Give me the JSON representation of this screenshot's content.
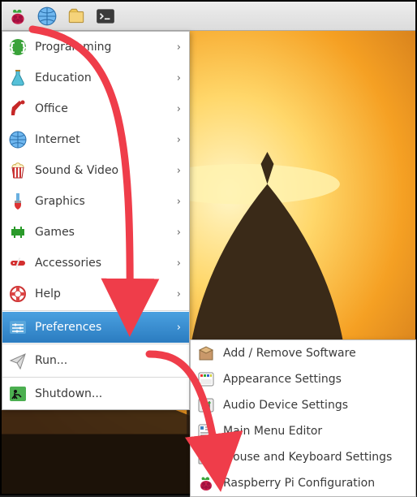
{
  "taskbar": {
    "items": [
      {
        "name": "raspberry-icon"
      },
      {
        "name": "globe-icon"
      },
      {
        "name": "files-icon"
      },
      {
        "name": "terminal-icon"
      }
    ]
  },
  "menu": {
    "items": [
      {
        "name": "programming",
        "label": "Programming",
        "icon": "braces-icon",
        "submenu": true
      },
      {
        "name": "education",
        "label": "Education",
        "icon": "flask-icon",
        "submenu": true
      },
      {
        "name": "office",
        "label": "Office",
        "icon": "lamp-icon",
        "submenu": true
      },
      {
        "name": "internet",
        "label": "Internet",
        "icon": "globe-icon",
        "submenu": true
      },
      {
        "name": "sound-video",
        "label": "Sound & Video",
        "icon": "popcorn-icon",
        "submenu": true
      },
      {
        "name": "graphics",
        "label": "Graphics",
        "icon": "brush-icon",
        "submenu": true
      },
      {
        "name": "games",
        "label": "Games",
        "icon": "invader-icon",
        "submenu": true
      },
      {
        "name": "accessories",
        "label": "Accessories",
        "icon": "knife-icon",
        "submenu": true
      },
      {
        "name": "help",
        "label": "Help",
        "icon": "lifebuoy-icon",
        "submenu": true
      }
    ],
    "preferences": {
      "name": "preferences",
      "label": "Preferences",
      "icon": "sliders-icon",
      "submenu": true,
      "selected": true
    },
    "run": {
      "name": "run",
      "label": "Run...",
      "icon": "paperplane-icon"
    },
    "shutdown": {
      "name": "shutdown",
      "label": "Shutdown...",
      "icon": "exit-icon"
    }
  },
  "submenu": {
    "items": [
      {
        "name": "add-remove-software",
        "label": "Add / Remove Software",
        "icon": "package-icon"
      },
      {
        "name": "appearance-settings",
        "label": "Appearance Settings",
        "icon": "palette-icon"
      },
      {
        "name": "audio-device-settings",
        "label": "Audio Device Settings",
        "icon": "audio-sliders-icon"
      },
      {
        "name": "main-menu-editor",
        "label": "Main Menu Editor",
        "icon": "menu-editor-icon"
      },
      {
        "name": "mouse-keyboard-settings",
        "label": "Mouse and Keyboard Settings",
        "icon": "mouse-keyboard-icon"
      },
      {
        "name": "raspberry-pi-config",
        "label": "Raspberry Pi Configuration",
        "icon": "raspberry-icon"
      }
    ]
  },
  "colors": {
    "arrow": "#ef3d4a",
    "highlight_a": "#4aa0e0",
    "highlight_b": "#2b7cc0"
  }
}
